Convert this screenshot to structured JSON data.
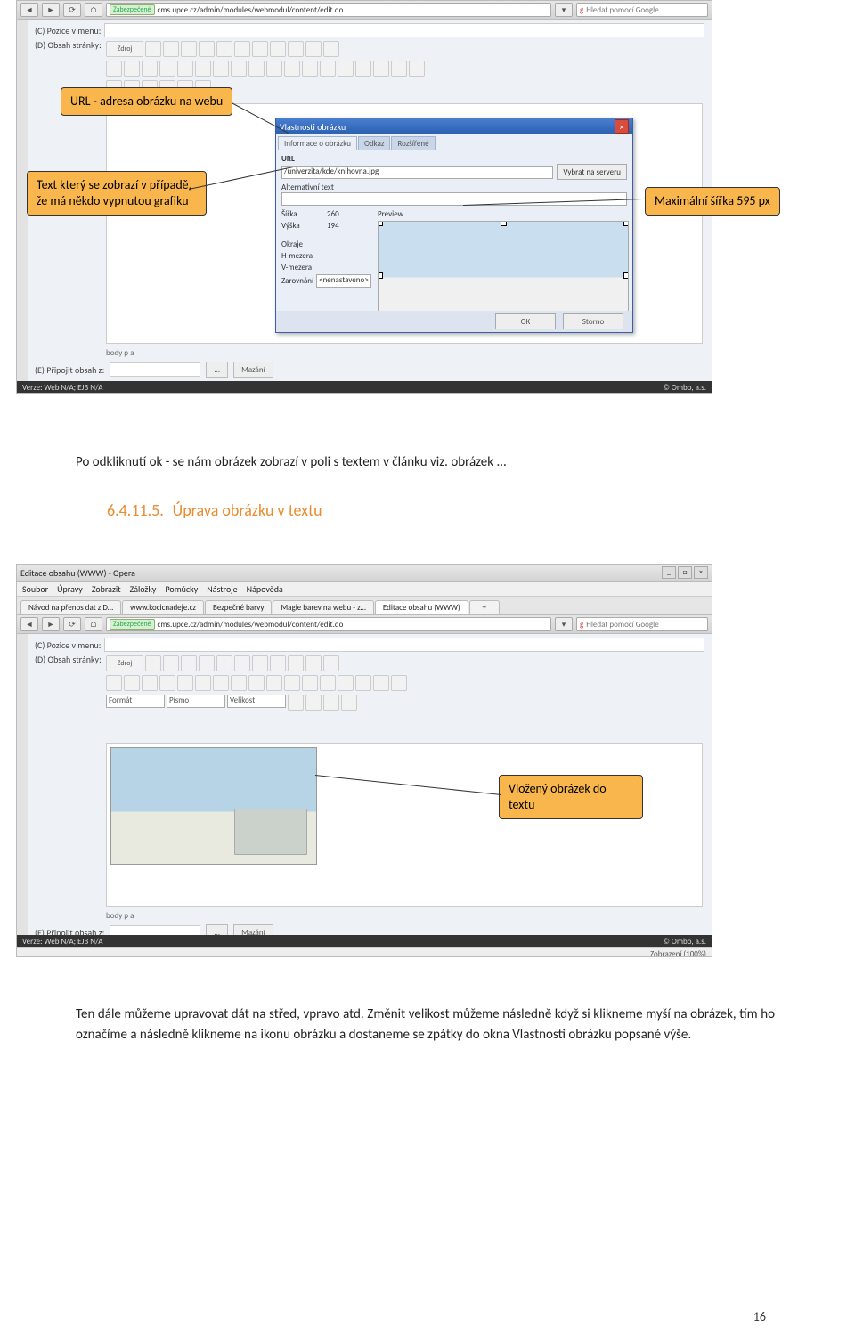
{
  "browser1": {
    "secure_label": "Zabezpečené",
    "url": "cms.upce.cz/admin/modules/webmodul/content/edit.do",
    "search_placeholder": "Hledat pomocí Google"
  },
  "cms1": {
    "row_c_label": "(C) Pozice v menu:",
    "row_d_label": "(D) Obsah stránky:",
    "src_btn": "Zdroj",
    "status": "body  p  a",
    "row_e_label": "(E) Připojit obsah z:",
    "browse_btn": "...",
    "delete_btn": "Mazání",
    "footer_left": "Verze: Web N/A; EJB N/A",
    "footer_right": "© Ombo, a.s."
  },
  "dlg": {
    "title": "Vlastnosti obrázku",
    "tab1": "Informace o obrázku",
    "tab2": "Odkaz",
    "tab3": "Rozšířené",
    "url_label": "URL",
    "url_value": "/univerzita/kde/knihovna.jpg",
    "server_btn": "Vybrat na serveru",
    "alt_label": "Alternativní text",
    "width_label": "Šířka",
    "width_value": "260",
    "height_label": "Výška",
    "height_value": "194",
    "border_label": "Okraje",
    "hspace_label": "H-mezera",
    "vspace_label": "V-mezera",
    "align_label": "Zarovnání",
    "align_value": "<nenastaveno>",
    "preview_label": "Preview",
    "ok": "OK",
    "cancel": "Storno"
  },
  "callouts": {
    "c1": "URL - adresa obrázku na webu",
    "c2": "Text který se zobrazí v případě, že má někdo vypnutou grafiku",
    "c3": "Maximální šířka 595 px",
    "c4": "Vložený obrázek do textu"
  },
  "text": {
    "p1": "Po odkliknutí ok - se nám obrázek zobrazí v poli s textem v článku viz. obrázek ...",
    "h_num": "6.4.11.5.",
    "h_text": "Úprava obrázku v textu",
    "p2": "Ten dále můžeme upravovat dát na střed, vpravo atd. Změnit velikost můžeme následně když si klikneme myší na obrázek, tím ho označíme a následně klikneme na ikonu obrázku a dostaneme se zpátky do okna Vlastnosti obrázku popsané výše."
  },
  "browser2": {
    "win_title": "Editace obsahu (WWW) - Opera",
    "menu": [
      "Soubor",
      "Úpravy",
      "Zobrazit",
      "Záložky",
      "Pomůcky",
      "Nástroje",
      "Nápověda"
    ],
    "tabs": [
      "Návod na přenos dat z D…",
      "www.kocicnadeje.cz",
      "Bezpečné barvy",
      "Magie barev na webu - z…",
      "Editace obsahu (WWW)"
    ],
    "secure_label": "Zabezpečené",
    "url": "cms.upce.cz/admin/modules/webmodul/content/edit.do",
    "search_placeholder": "Hledat pomocí Google",
    "format_label": "Formát",
    "font_label": "Písmo",
    "size_label": "Velikost",
    "zoom": "Zobrazení (100%)"
  },
  "page_number": "16"
}
